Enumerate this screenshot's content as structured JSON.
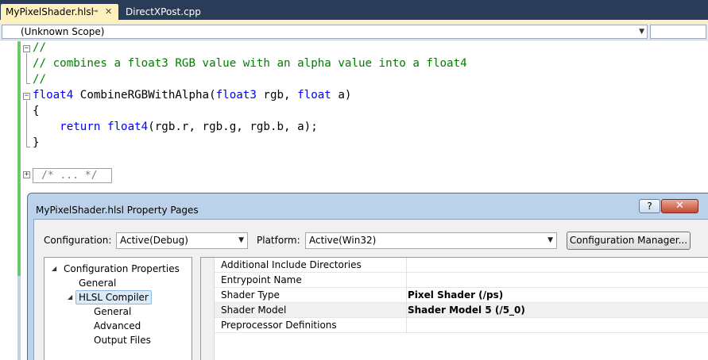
{
  "tabs": [
    {
      "label": "MyPixelShader.hlsl",
      "pin_glyph": "⊸",
      "close_glyph": "✕"
    },
    {
      "label": "DirectXPost.cpp"
    }
  ],
  "scope": {
    "value": "(Unknown Scope)"
  },
  "code": {
    "line1": "//",
    "line2": "// combines a float3 RGB value with an alpha value into a float4",
    "line3": "//",
    "line4_kw": "float4",
    "line4_fn": " CombineRGBWithAlpha(",
    "line4_type1": "float3",
    "line4_arg1": " rgb, ",
    "line4_type2": "float",
    "line4_arg2": " a)",
    "line5": "{",
    "line6_indent": "    ",
    "line6_kw1": "return",
    "line6_sp": " ",
    "line6_kw2": "float4",
    "line6_rest": "(rgb.r, rgb.g, rgb.b, a);",
    "line7": "}",
    "collapsed": "/* ... */"
  },
  "dialog": {
    "title": "MyPixelShader.hlsl Property Pages",
    "help_label": "?",
    "close_label": "✕",
    "configuration_label": "Configuration:",
    "configuration_value": "Active(Debug)",
    "platform_label": "Platform:",
    "platform_value": "Active(Win32)",
    "config_manager_label": "Configuration Manager...",
    "tree": [
      {
        "label": "Configuration Properties",
        "expanded": true
      },
      {
        "label": "General"
      },
      {
        "label": "HLSL Compiler",
        "expanded": true,
        "selected": true
      },
      {
        "label": "General"
      },
      {
        "label": "Advanced"
      },
      {
        "label": "Output Files"
      }
    ],
    "properties": [
      {
        "name": "Additional Include Directories",
        "value": ""
      },
      {
        "name": "Entrypoint Name",
        "value": ""
      },
      {
        "name": "Shader Type",
        "value": "Pixel Shader (/ps)"
      },
      {
        "name": "Shader Model",
        "value": "Shader Model 5 (/5_0)"
      },
      {
        "name": "Preprocessor Definitions",
        "value": ""
      }
    ]
  },
  "colors": {
    "tab_active": "#fff1bd",
    "tabstrip_bg": "#2b3c59",
    "comment": "#008000",
    "keyword": "#0000ff",
    "change_margin": "#6dc96d"
  }
}
